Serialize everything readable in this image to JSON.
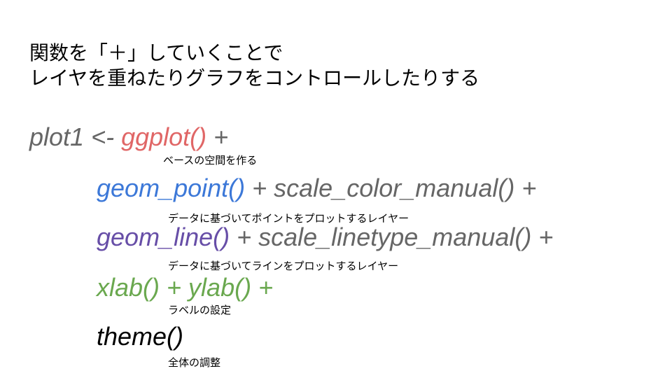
{
  "heading": {
    "line1": "関数を「＋」していくことで",
    "line2": "レイヤを重ねたりグラフをコントロールしたりする"
  },
  "colors": {
    "gray": "#666666",
    "red": "#e06666",
    "blue": "#3c78d8",
    "purple": "#674ea7",
    "green": "#6aa84f",
    "black": "#000000"
  },
  "code": {
    "line1": {
      "assign": "plot1 <- ",
      "fn": "ggplot()",
      "plus": " +"
    },
    "line2": {
      "fn": "geom_point()",
      "rest": " + scale_color_manual() +"
    },
    "line3": {
      "fn": "geom_line()",
      "rest": " + scale_linetype_manual() +"
    },
    "line4": {
      "fn": "xlab() + ylab() +"
    },
    "line5": {
      "fn": "theme()"
    }
  },
  "notes": {
    "base": "ベースの空間を作る",
    "points": "データに基づいてポイントをプロットするレイヤー",
    "lines": "データに基づいてラインをプロットするレイヤー",
    "labels": "ラベルの設定",
    "theme": "全体の調整"
  }
}
